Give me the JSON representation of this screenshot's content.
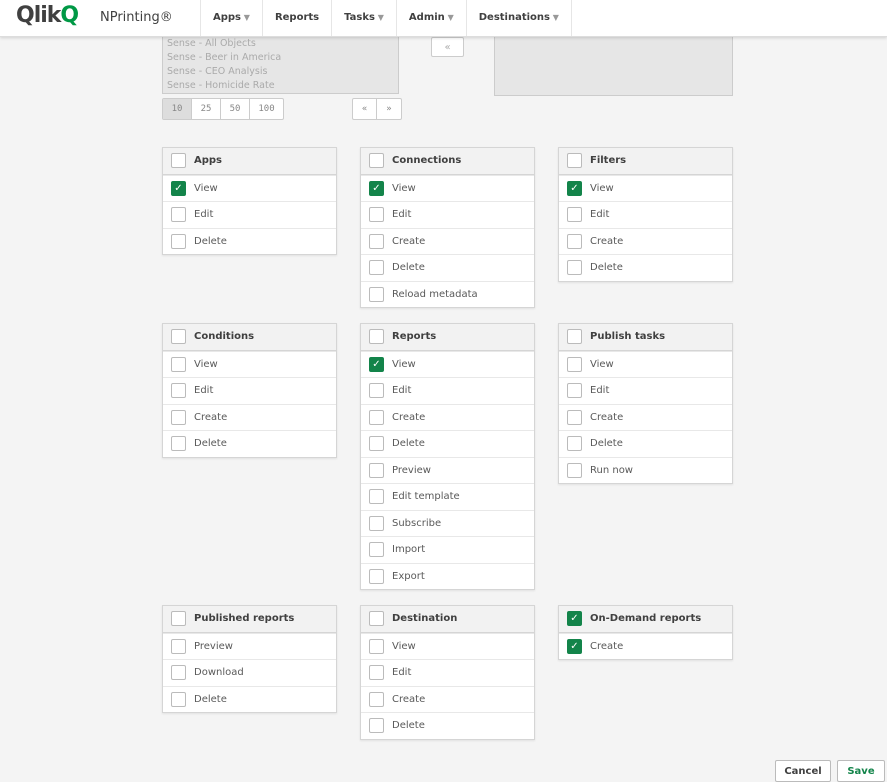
{
  "header": {
    "logo": "Qlik",
    "product": "NPrinting®",
    "nav": [
      "Apps",
      "Reports",
      "Tasks",
      "Admin",
      "Destinations"
    ],
    "nav_dropdown": [
      true,
      false,
      true,
      true,
      true
    ]
  },
  "source_list": [
    "Sense - All Objects",
    "Sense - Beer in America",
    "Sense - CEO Analysis",
    "Sense - Homicide Rate"
  ],
  "move_left_label": "«",
  "page_sizes": [
    "10",
    "25",
    "50",
    "100"
  ],
  "selected_page_size": "10",
  "pager": [
    "«",
    "»"
  ],
  "accent": "#13844a",
  "cards": [
    {
      "title": "Apps",
      "checked": false,
      "items": [
        {
          "label": "View",
          "checked": true
        },
        {
          "label": "Edit",
          "checked": false
        },
        {
          "label": "Delete",
          "checked": false
        }
      ]
    },
    {
      "title": "Connections",
      "checked": false,
      "items": [
        {
          "label": "View",
          "checked": true
        },
        {
          "label": "Edit",
          "checked": false
        },
        {
          "label": "Create",
          "checked": false
        },
        {
          "label": "Delete",
          "checked": false
        },
        {
          "label": "Reload metadata",
          "checked": false
        }
      ]
    },
    {
      "title": "Filters",
      "checked": false,
      "items": [
        {
          "label": "View",
          "checked": true
        },
        {
          "label": "Edit",
          "checked": false
        },
        {
          "label": "Create",
          "checked": false
        },
        {
          "label": "Delete",
          "checked": false
        }
      ]
    },
    {
      "title": "Conditions",
      "checked": false,
      "items": [
        {
          "label": "View",
          "checked": false
        },
        {
          "label": "Edit",
          "checked": false
        },
        {
          "label": "Create",
          "checked": false
        },
        {
          "label": "Delete",
          "checked": false
        }
      ]
    },
    {
      "title": "Reports",
      "checked": false,
      "items": [
        {
          "label": "View",
          "checked": true
        },
        {
          "label": "Edit",
          "checked": false
        },
        {
          "label": "Create",
          "checked": false
        },
        {
          "label": "Delete",
          "checked": false
        },
        {
          "label": "Preview",
          "checked": false
        },
        {
          "label": "Edit template",
          "checked": false
        },
        {
          "label": "Subscribe",
          "checked": false
        },
        {
          "label": "Import",
          "checked": false
        },
        {
          "label": "Export",
          "checked": false
        }
      ]
    },
    {
      "title": "Publish tasks",
      "checked": false,
      "items": [
        {
          "label": "View",
          "checked": false
        },
        {
          "label": "Edit",
          "checked": false
        },
        {
          "label": "Create",
          "checked": false
        },
        {
          "label": "Delete",
          "checked": false
        },
        {
          "label": "Run now",
          "checked": false
        }
      ]
    },
    {
      "title": "Published reports",
      "checked": false,
      "items": [
        {
          "label": "Preview",
          "checked": false
        },
        {
          "label": "Download",
          "checked": false
        },
        {
          "label": "Delete",
          "checked": false
        }
      ]
    },
    {
      "title": "Destination",
      "checked": false,
      "items": [
        {
          "label": "View",
          "checked": false
        },
        {
          "label": "Edit",
          "checked": false
        },
        {
          "label": "Create",
          "checked": false
        },
        {
          "label": "Delete",
          "checked": false
        }
      ]
    },
    {
      "title": "On-Demand reports",
      "checked": true,
      "items": [
        {
          "label": "Create",
          "checked": true
        }
      ]
    }
  ],
  "footer": {
    "cancel": "Cancel",
    "save": "Save"
  }
}
